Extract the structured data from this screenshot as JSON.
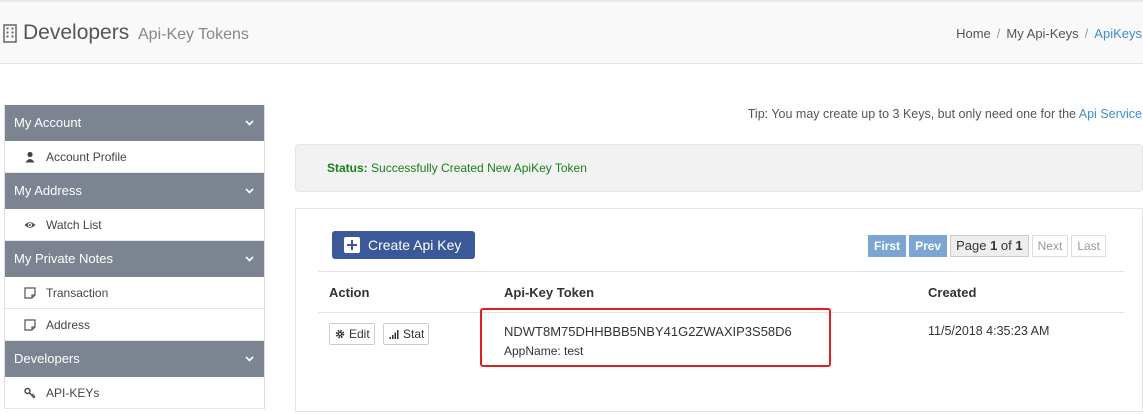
{
  "header": {
    "title": "Developers",
    "subtitle": "Api-Key Tokens",
    "title_icon": "building-icon",
    "breadcrumb": {
      "home": "Home",
      "separator": "/",
      "my_api_keys": "My Api-Keys",
      "current": "ApiKeys"
    }
  },
  "sidebar": {
    "sections": [
      {
        "label": "My Account",
        "items": [
          {
            "label": "Account Profile",
            "icon": "user-icon"
          }
        ]
      },
      {
        "label": "My Address",
        "items": [
          {
            "label": "Watch List",
            "icon": "eye-icon"
          }
        ]
      },
      {
        "label": "My Private Notes",
        "items": [
          {
            "label": "Transaction",
            "icon": "note-icon"
          },
          {
            "label": "Address",
            "icon": "note-icon"
          }
        ]
      },
      {
        "label": "Developers",
        "items": [
          {
            "label": "API-KEYs",
            "icon": "key-icon"
          }
        ]
      }
    ]
  },
  "tip": {
    "text": "Tip: You may create up to 3 Keys, but only need one for the ",
    "link": "Api Service"
  },
  "status": {
    "label": "Status:",
    "message": "Successfully Created New ApiKey Token"
  },
  "panel": {
    "create_button": "Create Api Key",
    "pager": {
      "first": "First",
      "prev": "Prev",
      "page_prefix": "Page ",
      "page_current": "1",
      "page_of": " of ",
      "page_total": "1",
      "next": "Next",
      "last": "Last"
    },
    "table": {
      "headers": {
        "action": "Action",
        "token": "Api-Key Token",
        "created": "Created"
      },
      "rows": [
        {
          "edit": "Edit",
          "stat": "Stat",
          "token": "NDWT8M75DHHBBB5NBY41G2ZWAXIP3S58D6",
          "appname": "AppName: test",
          "created": "11/5/2018 4:35:23 AM"
        }
      ]
    }
  },
  "colors": {
    "sidebar_header": "#7c8491",
    "link": "#3a8ed3",
    "status_text": "#1a7f1a",
    "create_button": "#3b5998",
    "pager_active": "#7ba6d4",
    "highlight": "#e02020"
  }
}
